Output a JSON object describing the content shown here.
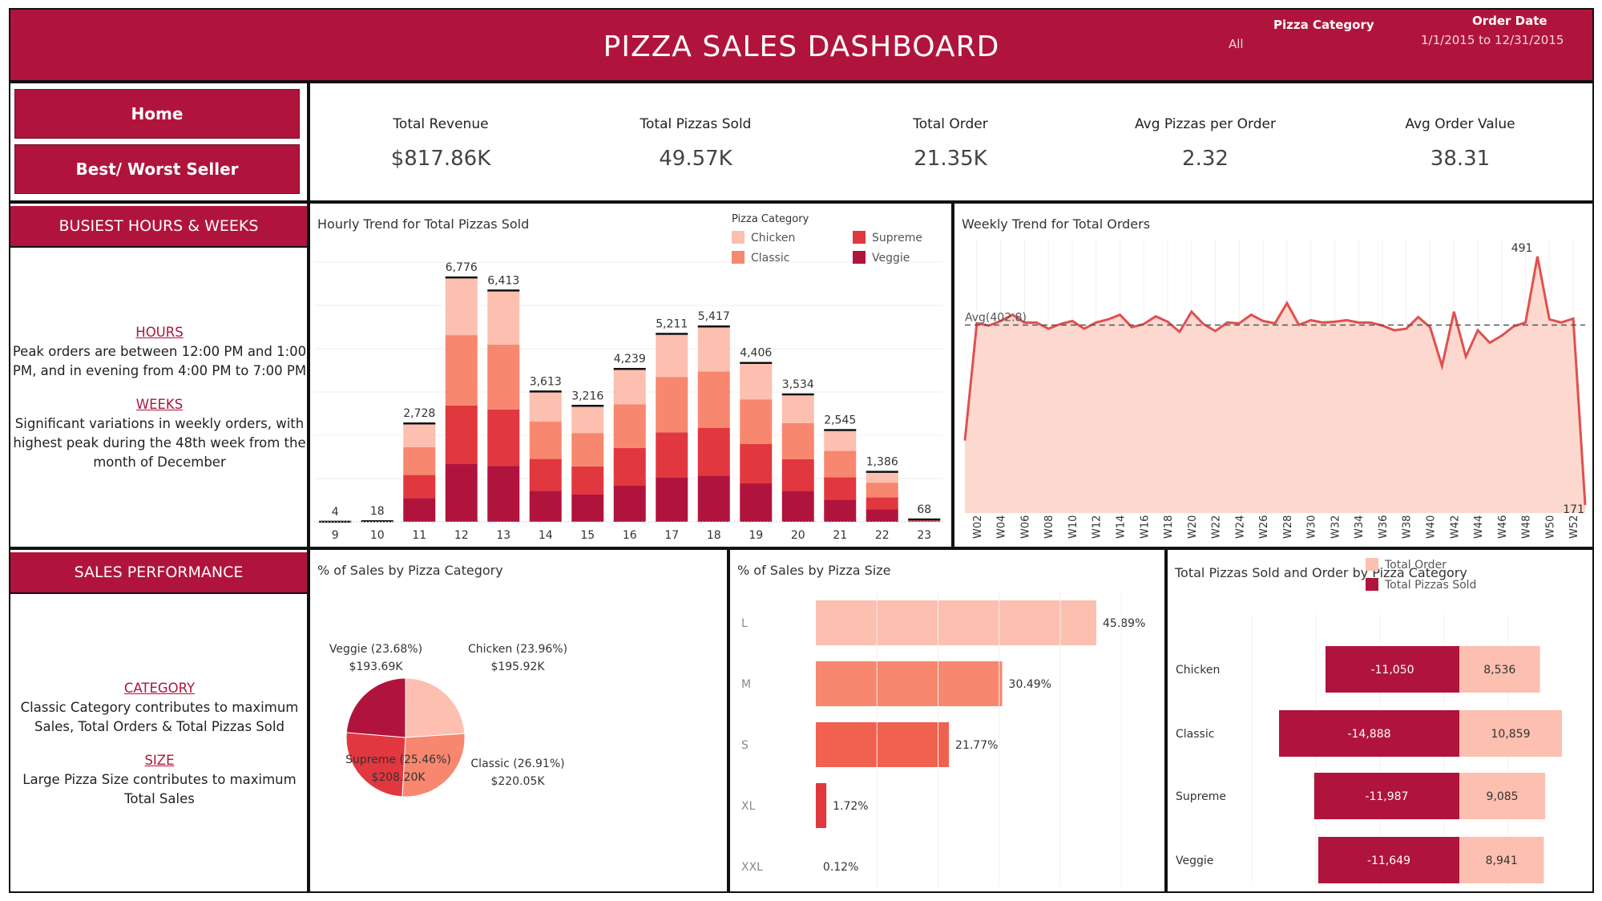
{
  "header": {
    "title": "PIZZA SALES DASHBOARD",
    "filter_category_label": "Pizza Category",
    "filter_category_value": "All",
    "filter_date_label": "Order Date",
    "filter_date_value": "1/1/2015 to 12/31/2015"
  },
  "nav": {
    "home": "Home",
    "best_worst": "Best/ Worst Seller"
  },
  "kpis": [
    {
      "label": "Total Revenue",
      "value": "$817.86K"
    },
    {
      "label": "Total Pizzas Sold",
      "value": "49.57K"
    },
    {
      "label": "Total Order",
      "value": "21.35K"
    },
    {
      "label": "Avg Pizzas per Order",
      "value": "2.32"
    },
    {
      "label": "Avg Order Value",
      "value": "38.31"
    }
  ],
  "busiest": {
    "heading": "BUSIEST HOURS & WEEKS",
    "hours_kw": "HOURS",
    "hours_text": "Peak orders are between 12:00 PM and 1:00 PM, and in evening from 4:00 PM to 7:00 PM",
    "weeks_kw": "WEEKS",
    "weeks_text": "Significant variations in weekly orders, with highest peak during the 48th week from the month of December"
  },
  "performance": {
    "heading": "SALES PERFORMANCE",
    "category_kw": "CATEGORY",
    "category_text": "Classic Category contributes to maximum Sales, Total Orders & Total Pizzas Sold",
    "size_kw": "SIZE",
    "size_text": "Large Pizza Size contributes to maximum Total Sales"
  },
  "colors": {
    "brand": "#b0143c",
    "chicken": "#fcbfb0",
    "classic": "#f7876e",
    "supreme": "#e1373f",
    "veggie": "#b0143c",
    "area_fill": "#fdd8cf",
    "line": "#e0504f"
  },
  "chart_data": [
    {
      "type": "bar",
      "title": "Hourly Trend for Total Pizzas Sold",
      "legend_title": "Pizza Category",
      "legend_position": "top-right",
      "categories": [
        "9",
        "10",
        "11",
        "12",
        "13",
        "14",
        "15",
        "16",
        "17",
        "18",
        "19",
        "20",
        "21",
        "22",
        "23"
      ],
      "totals": [
        4,
        18,
        2728,
        6776,
        6413,
        3613,
        3216,
        4239,
        5211,
        5417,
        4406,
        3534,
        2545,
        1386,
        68
      ],
      "series": [
        {
          "name": "Chicken",
          "values": [
            1,
            4,
            660,
            1600,
            1500,
            830,
            760,
            980,
            1200,
            1250,
            1010,
            800,
            580,
            300,
            15
          ]
        },
        {
          "name": "Classic",
          "values": [
            1,
            5,
            770,
            1950,
            1800,
            1040,
            920,
            1210,
            1530,
            1560,
            1240,
            1000,
            730,
            410,
            20
          ]
        },
        {
          "name": "Supreme",
          "values": [
            1,
            5,
            640,
            1610,
            1560,
            880,
            780,
            1040,
            1250,
            1330,
            1090,
            880,
            620,
            330,
            17
          ]
        },
        {
          "name": "Veggie",
          "values": [
            1,
            4,
            658,
            1616,
            1553,
            863,
            756,
            1009,
            1231,
            1277,
            1066,
            854,
            615,
            346,
            16
          ]
        }
      ]
    },
    {
      "type": "area",
      "title": "Weekly Trend for Total Orders",
      "average_label": "Avg(402.8)",
      "average": 402.8,
      "x_tick_labels": [
        "W02",
        "W04",
        "W06",
        "W08",
        "W10",
        "W12",
        "W14",
        "W16",
        "W18",
        "W20",
        "W22",
        "W24",
        "W26",
        "W28",
        "W30",
        "W32",
        "W34",
        "W36",
        "W38",
        "W40",
        "W42",
        "W44",
        "W46",
        "W48",
        "W50",
        "W52"
      ],
      "weeks": [
        1,
        2,
        3,
        4,
        5,
        6,
        7,
        8,
        9,
        10,
        11,
        12,
        13,
        14,
        15,
        16,
        17,
        18,
        19,
        20,
        21,
        22,
        23,
        24,
        25,
        26,
        27,
        28,
        29,
        30,
        31,
        32,
        33,
        34,
        35,
        36,
        37,
        38,
        39,
        40,
        41,
        42,
        43,
        44,
        45,
        46,
        47,
        48,
        49,
        50,
        51,
        52,
        53
      ],
      "values": [
        254,
        405,
        402,
        408,
        416,
        406,
        406,
        398,
        404,
        408,
        398,
        406,
        410,
        416,
        400,
        404,
        414,
        407,
        394,
        420,
        404,
        395,
        406,
        405,
        416,
        408,
        405,
        431,
        403,
        409,
        406,
        407,
        409,
        406,
        406,
        402,
        396,
        398,
        413,
        400,
        350,
        420,
        362,
        396,
        380,
        389,
        401,
        406,
        491,
        410,
        406,
        411,
        171
      ],
      "label_max": "491",
      "label_min": "171"
    },
    {
      "type": "pie",
      "title": "% of Sales by Pizza Category",
      "slices": [
        {
          "name": "Chicken",
          "pct": 23.96,
          "label": "Chicken (23.96%)",
          "value_label": "$195.92K"
        },
        {
          "name": "Classic",
          "pct": 26.91,
          "label": "Classic (26.91%)",
          "value_label": "$220.05K"
        },
        {
          "name": "Supreme",
          "pct": 25.46,
          "label": "Supreme (25.46%)",
          "value_label": "$208.20K"
        },
        {
          "name": "Veggie",
          "pct": 23.68,
          "label": "Veggie (23.68%)",
          "value_label": "$193.69K"
        }
      ]
    },
    {
      "type": "bar",
      "orientation": "horizontal",
      "title": "% of Sales by Pizza Size",
      "categories": [
        "L",
        "M",
        "S",
        "XL",
        "XXL"
      ],
      "values": [
        45.89,
        30.49,
        21.77,
        1.72,
        0.12
      ],
      "value_labels": [
        "45.89%",
        "30.49%",
        "21.77%",
        "1.72%",
        "0.12%"
      ]
    },
    {
      "type": "bar",
      "orientation": "horizontal-diverging",
      "title": "Total Pizzas Sold and Order by Pizza Category",
      "categories": [
        "Chicken",
        "Classic",
        "Supreme",
        "Veggie"
      ],
      "series": [
        {
          "name": "Total Order",
          "values": [
            8536,
            10859,
            9085,
            8941
          ],
          "labels": [
            "8,536",
            "10,859",
            "9,085",
            "8,941"
          ]
        },
        {
          "name": "Total Pizzas Sold",
          "values": [
            -11050,
            -14888,
            -11987,
            -11649
          ],
          "labels": [
            "-11,050",
            "-14,888",
            "-11,987",
            "-11,649"
          ]
        }
      ]
    }
  ]
}
